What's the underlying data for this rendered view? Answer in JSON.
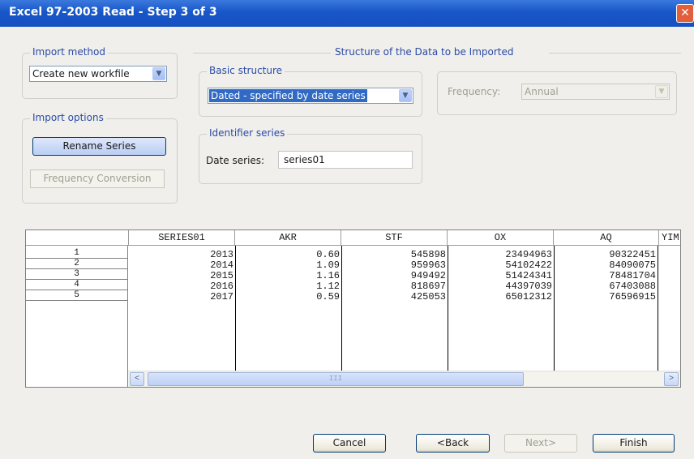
{
  "window": {
    "title": "Excel 97-2003 Read - Step 3 of 3",
    "close_label": "✕"
  },
  "import_method": {
    "legend": "Import method",
    "value": "Create new workfile"
  },
  "import_options": {
    "legend": "Import options",
    "rename_label": "Rename Series",
    "freq_conv_label": "Frequency Conversion"
  },
  "structure": {
    "heading": "Structure of the Data to be Imported",
    "basic_legend": "Basic structure",
    "basic_value": "Dated - specified by date series",
    "frequency_label": "Frequency:",
    "frequency_value": "Annual",
    "identifier_legend": "Identifier series",
    "date_series_label": "Date series:",
    "date_series_value": "series01"
  },
  "grid": {
    "columns": [
      "SERIES01",
      "AKR",
      "STF",
      "OX",
      "AQ",
      "YIM"
    ],
    "row_numbers": [
      "1",
      "2",
      "3",
      "4",
      "5"
    ],
    "rows": [
      [
        "2013",
        "0.60",
        "545898",
        "23494963",
        "90322451"
      ],
      [
        "2014",
        "1.09",
        "959963",
        "54102422",
        "84090075"
      ],
      [
        "2015",
        "1.16",
        "949492",
        "51424341",
        "78481704"
      ],
      [
        "2016",
        "1.12",
        "818697",
        "44397039",
        "67403088"
      ],
      [
        "2017",
        "0.59",
        "425053",
        "65012312",
        "76596915"
      ]
    ],
    "scroll_left": "<",
    "scroll_right": ">",
    "thumb_grip": "III"
  },
  "buttons": {
    "cancel": "Cancel",
    "back": "<Back",
    "next": "Next>",
    "finish": "Finish"
  }
}
